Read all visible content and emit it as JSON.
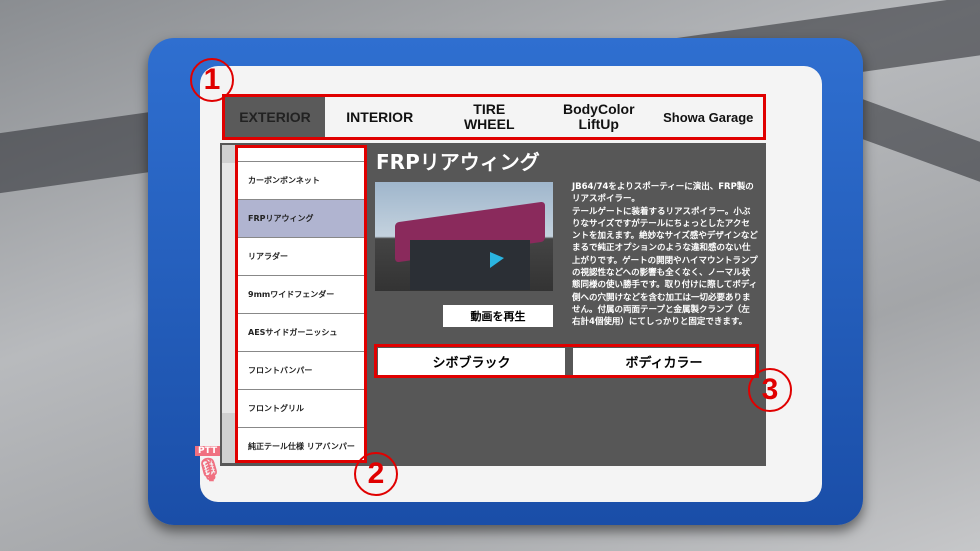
{
  "tabs": [
    "EXTERIOR",
    "INTERIOR",
    "TIRE\nWHEEL",
    "BodyColor\nLiftUp",
    "Showa Garage"
  ],
  "list": [
    "カーボンボンネット",
    "FRPリアウィング",
    "リアラダー",
    "9mmワイドフェンダー",
    "AESサイドガーニッシュ",
    "フロントバンパー",
    "フロントグリル",
    "純正テール仕様 リアバンパー"
  ],
  "selected_index": 1,
  "detail": {
    "title": "FRPリアウィング",
    "description": "JB64/74をよりスポーティーに演出、FRP製のリアスポイラー。\nテールゲートに装着するリアスポイラー。小ぶりなサイズですがテールにちょっとしたアクセントを加えます。絶妙なサイズ感やデザインなどまるで純正オプションのような違和感のない仕上がりです。ゲートの開閉やハイマウントランプの視認性などへの影響も全くなく、ノーマル状態同様の使い勝手です。取り付けに際してボディ側への穴開けなどを含む加工は一切必要ありません。付属の両面テープと金属製クランプ（左右計4個使用）にてしっかりと固定できます。",
    "play_label": "動画を再生",
    "options": [
      "シボブラック",
      "ボディカラー"
    ]
  },
  "annotations": [
    "1",
    "2",
    "3"
  ],
  "ptt_label": "PTT",
  "colors": {
    "frame": "#1f58b8",
    "highlight": "#e00000",
    "selected": "#b0b4d0",
    "content_bg": "#575757"
  }
}
